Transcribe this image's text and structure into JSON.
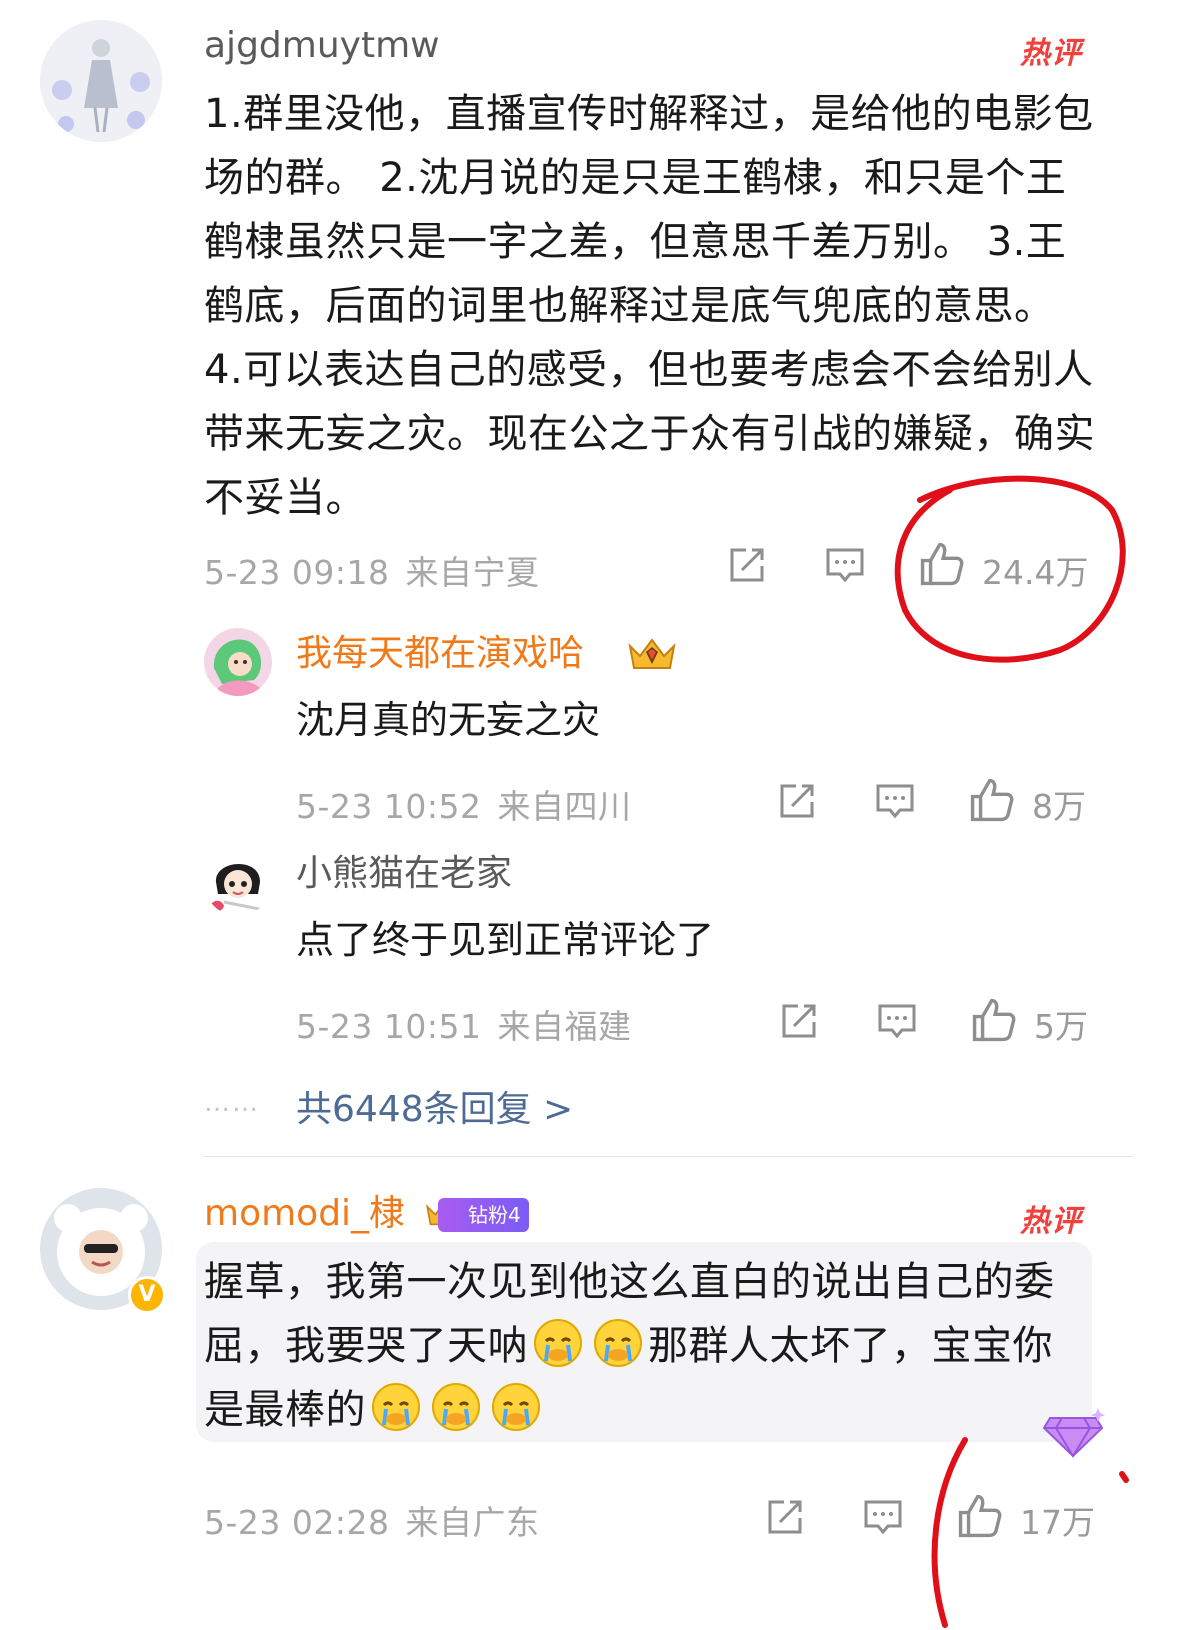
{
  "comment1": {
    "username": "ajgdmuytmw",
    "hot_label": "热评",
    "text": "1.群里没他，直播宣传时解释过，是给他的电影包场的群。 2.沈月说的是只是王鹤棣，和只是个王鹤棣虽然只是一字之差，但意思千差万别。 3.王鹤底，后面的词里也解释过是底气兜底的意思。 4.可以表达自己的感受，但也要考虑会不会给别人带来无妄之灾。现在公之于众有引战的嫌疑，确实不妥当。",
    "date": "5-23 09:18",
    "location": "来自宁夏",
    "likes": "24.4万"
  },
  "reply1": {
    "username": "我每天都在演戏哈",
    "text": "沈月真的无妄之灾",
    "date": "5-23 10:52",
    "location": "来自四川",
    "likes": "8万"
  },
  "reply2": {
    "username": "小熊猫在老家",
    "text": "点了终于见到正常评论了",
    "date": "5-23 10:51",
    "location": "来自福建",
    "likes": "5万"
  },
  "more_replies": {
    "dots": "……",
    "label": "共6448条回复 >"
  },
  "comment2": {
    "username": "momodi_棣",
    "fan_badge": "钻粉4",
    "hot_label": "热评",
    "text_part1": "握草，我第一次见到他这么直白的说出自己的委屈，我要哭了天呐",
    "text_part2": "那群人太坏了，宝宝你是最棒的",
    "verify_mark": "V",
    "date": "5-23 02:28",
    "location": "来自广东",
    "likes": "17万"
  },
  "colors": {
    "orange_name": "#f07a1a",
    "gray_name": "#5a5a5a",
    "link_blue": "#4d6b95",
    "hot_red": "#f0413c",
    "annotation_red": "#e0101a"
  }
}
